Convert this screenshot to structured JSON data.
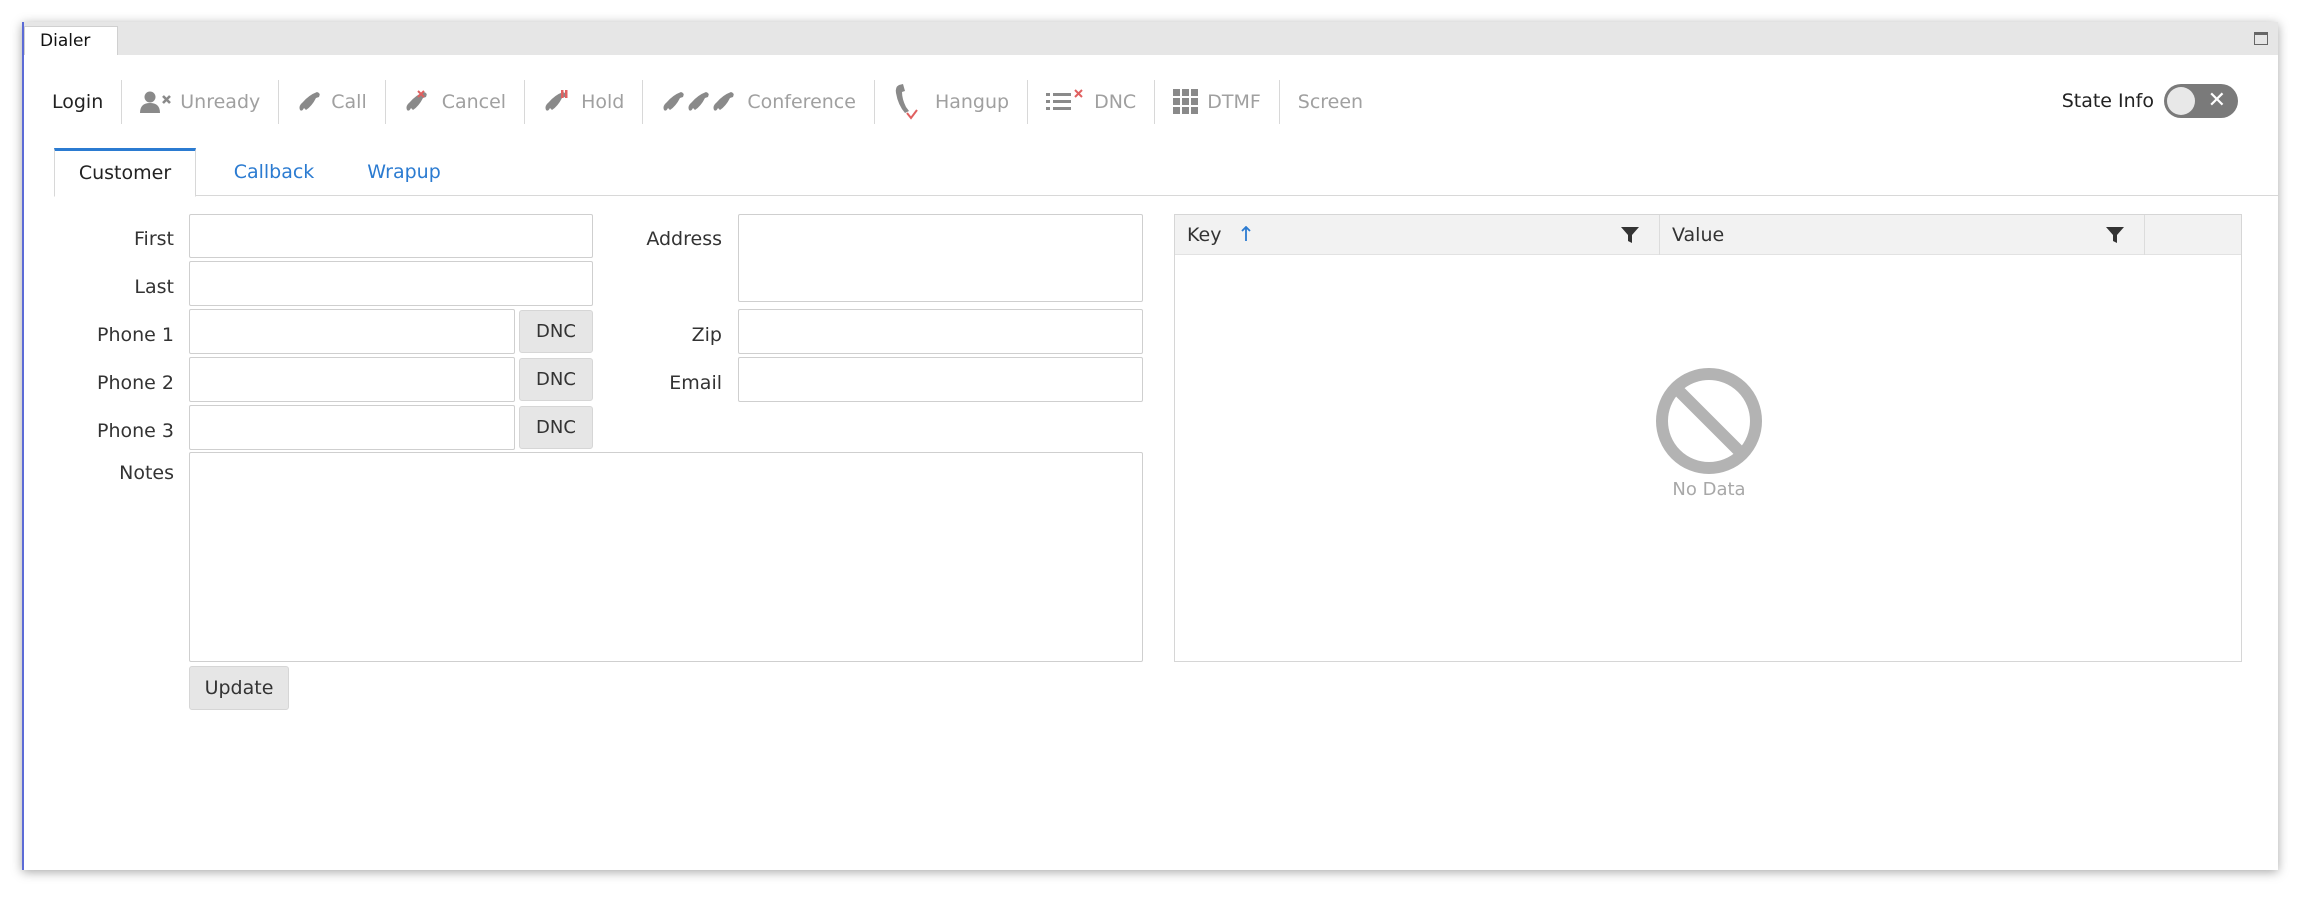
{
  "window": {
    "title": "Dialer"
  },
  "toolbar": {
    "login": "Login",
    "unready": "Unready",
    "call": "Call",
    "cancel": "Cancel",
    "hold": "Hold",
    "conference": "Conference",
    "hangup": "Hangup",
    "dnc": "DNC",
    "dtmf": "DTMF",
    "screen": "Screen",
    "state_info": "State Info"
  },
  "tabs": [
    {
      "label": "Customer",
      "active": true
    },
    {
      "label": "Callback",
      "active": false
    },
    {
      "label": "Wrapup",
      "active": false
    }
  ],
  "form": {
    "first_label": "First",
    "last_label": "Last",
    "phone1_label": "Phone 1",
    "phone2_label": "Phone 2",
    "phone3_label": "Phone 3",
    "notes_label": "Notes",
    "address_label": "Address",
    "zip_label": "Zip",
    "email_label": "Email",
    "dnc_label": "DNC",
    "update_label": "Update",
    "first_value": "",
    "last_value": "",
    "phone1_value": "",
    "phone2_value": "",
    "phone3_value": "",
    "notes_value": "",
    "address_value": "",
    "zip_value": "",
    "email_value": ""
  },
  "grid": {
    "columns": [
      "Key",
      "Value"
    ],
    "empty_text": "No Data"
  },
  "colors": {
    "accent": "#2b7bd1",
    "disabled_text": "#a0a0a0",
    "red_icon": "#e06060"
  }
}
